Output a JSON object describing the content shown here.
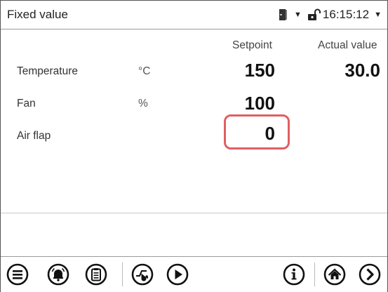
{
  "header": {
    "title": "Fixed value",
    "time": "16:15:12",
    "icons": [
      "door-icon",
      "dropdown-caret-icon",
      "unlock-icon",
      "dropdown-caret-icon"
    ]
  },
  "columns": {
    "setpoint": "Setpoint",
    "actual": "Actual value"
  },
  "rows": [
    {
      "label": "Temperature",
      "unit": "°C",
      "setpoint": "150",
      "actual": "30.0"
    },
    {
      "label": "Fan",
      "unit": "%",
      "setpoint": "100",
      "actual": ""
    },
    {
      "label": "Air flap",
      "unit": "",
      "setpoint": "0",
      "actual": ""
    }
  ],
  "highlight_color": "#e05f62",
  "footer": {
    "icons": [
      "menu-icon",
      "alarm-icon",
      "list-icon",
      "program-icon",
      "play-icon",
      "info-icon",
      "home-icon",
      "next-icon"
    ]
  }
}
